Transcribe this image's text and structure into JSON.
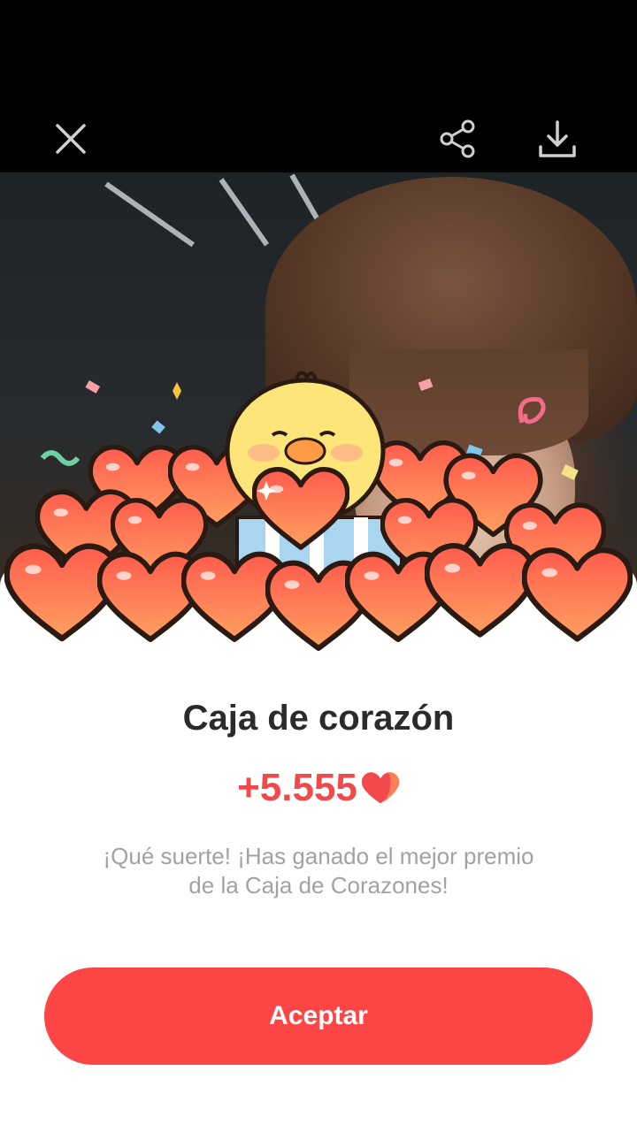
{
  "toolbar": {
    "close_icon": "close-icon",
    "share_icon": "share-icon",
    "download_icon": "download-icon"
  },
  "reward": {
    "title": "Caja de corazón",
    "amount": "+5.555",
    "currency_icon": "heart-icon",
    "message": "¡Qué suerte! ¡Has ganado el mejor premio de la Caja de Corazones!",
    "accept_label": "Aceptar"
  },
  "colors": {
    "accent": "#fd4545",
    "amount": "#f24a4c",
    "title": "#2b2b2b",
    "message": "#a2a2a2"
  }
}
